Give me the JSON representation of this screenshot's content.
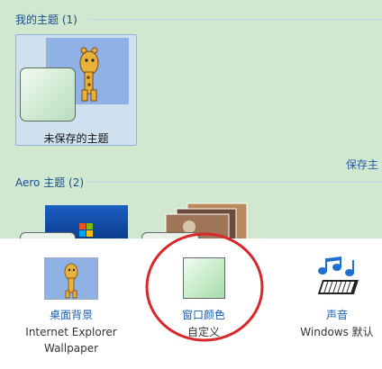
{
  "my_themes": {
    "title": "我的主题 (1)",
    "unsaved_label": "未保存的主题",
    "save_link": "保存主"
  },
  "aero_themes": {
    "title": "Aero 主题 (2)"
  },
  "bottom": {
    "desktop_bg": {
      "label": "桌面背景",
      "sub": "Internet Explorer Wallpaper"
    },
    "window_color": {
      "label": "窗口颜色",
      "sub": "自定义"
    },
    "sounds": {
      "label": "声音",
      "sub": "Windows 默认"
    }
  },
  "colors": {
    "highlight_ring": "#d8262a",
    "link": "#1a5fb0",
    "pane": "#cfe8cf"
  }
}
